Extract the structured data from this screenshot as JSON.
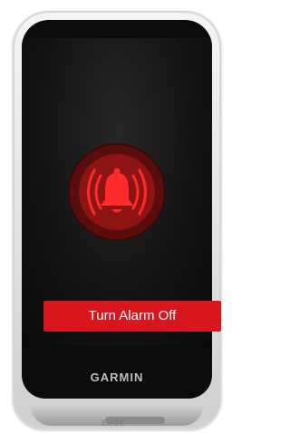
{
  "screen": {
    "alarm_icon": "bell-ringing-icon",
    "button_label": "Turn Alarm Off"
  },
  "device": {
    "brand": "GARMIN",
    "bottom_text": "EDGE"
  },
  "colors": {
    "accent": "#d9151d",
    "ring_outer": "#5a0d0d",
    "ring_inner": "#8e1313",
    "screen_bg": "#121212"
  }
}
